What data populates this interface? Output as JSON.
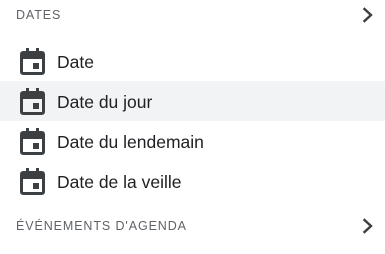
{
  "sections": {
    "dates": {
      "title": "DATES",
      "expand_icon": "chevron-right-icon",
      "items": [
        {
          "label": "Date",
          "icon": "calendar-event-icon",
          "highlighted": false
        },
        {
          "label": "Date du jour",
          "icon": "calendar-event-icon",
          "highlighted": true
        },
        {
          "label": "Date du lendemain",
          "icon": "calendar-event-icon",
          "highlighted": false
        },
        {
          "label": "Date de la veille",
          "icon": "calendar-event-icon",
          "highlighted": false
        }
      ]
    },
    "calendar_events": {
      "title": "ÉVÉNEMENTS D'AGENDA",
      "expand_icon": "chevron-right-icon"
    }
  },
  "colors": {
    "header_text": "#5f6368",
    "item_text": "#202124",
    "icon": "#3c4043",
    "hover_bg": "#f1f3f4"
  }
}
